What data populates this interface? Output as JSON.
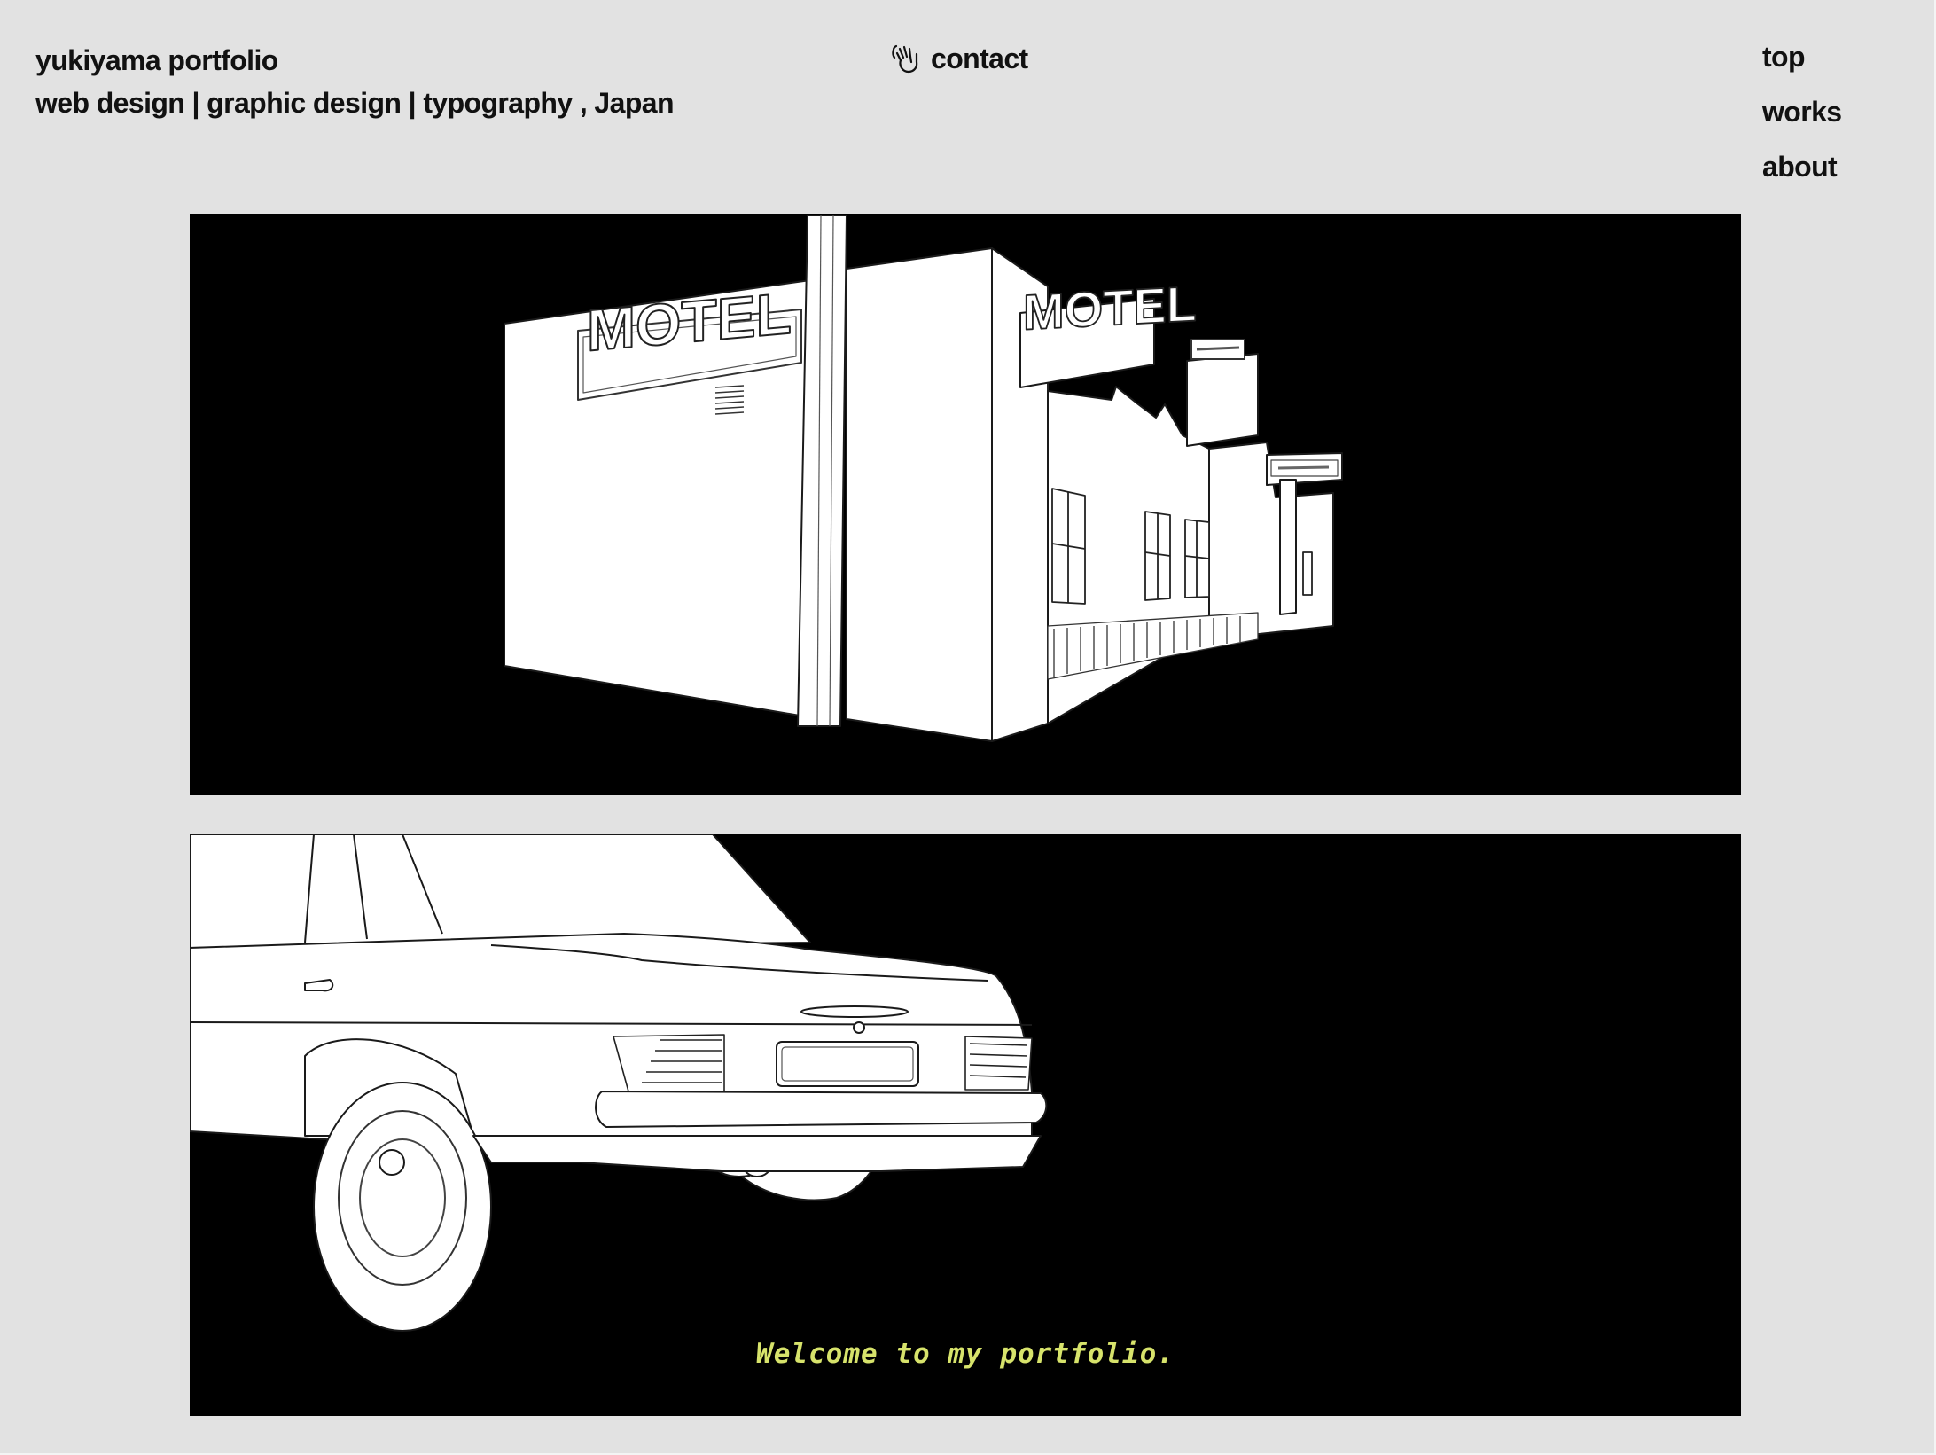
{
  "header": {
    "site_title": "yukiyama portfolio",
    "tagline": "web design | graphic design | typography , Japan",
    "contact_label": "contact",
    "contact_icon": "waving-hand-icon"
  },
  "nav": {
    "items": [
      {
        "label": "top"
      },
      {
        "label": "works"
      },
      {
        "label": "about"
      }
    ]
  },
  "hero": {
    "motel_sign_left": "MOTEL",
    "motel_sign_right": "MOTEL",
    "caption": "Welcome to my portfolio.",
    "caption_color": "#d7e36b",
    "background_color": "#000000",
    "line_color": "#ffffff"
  }
}
